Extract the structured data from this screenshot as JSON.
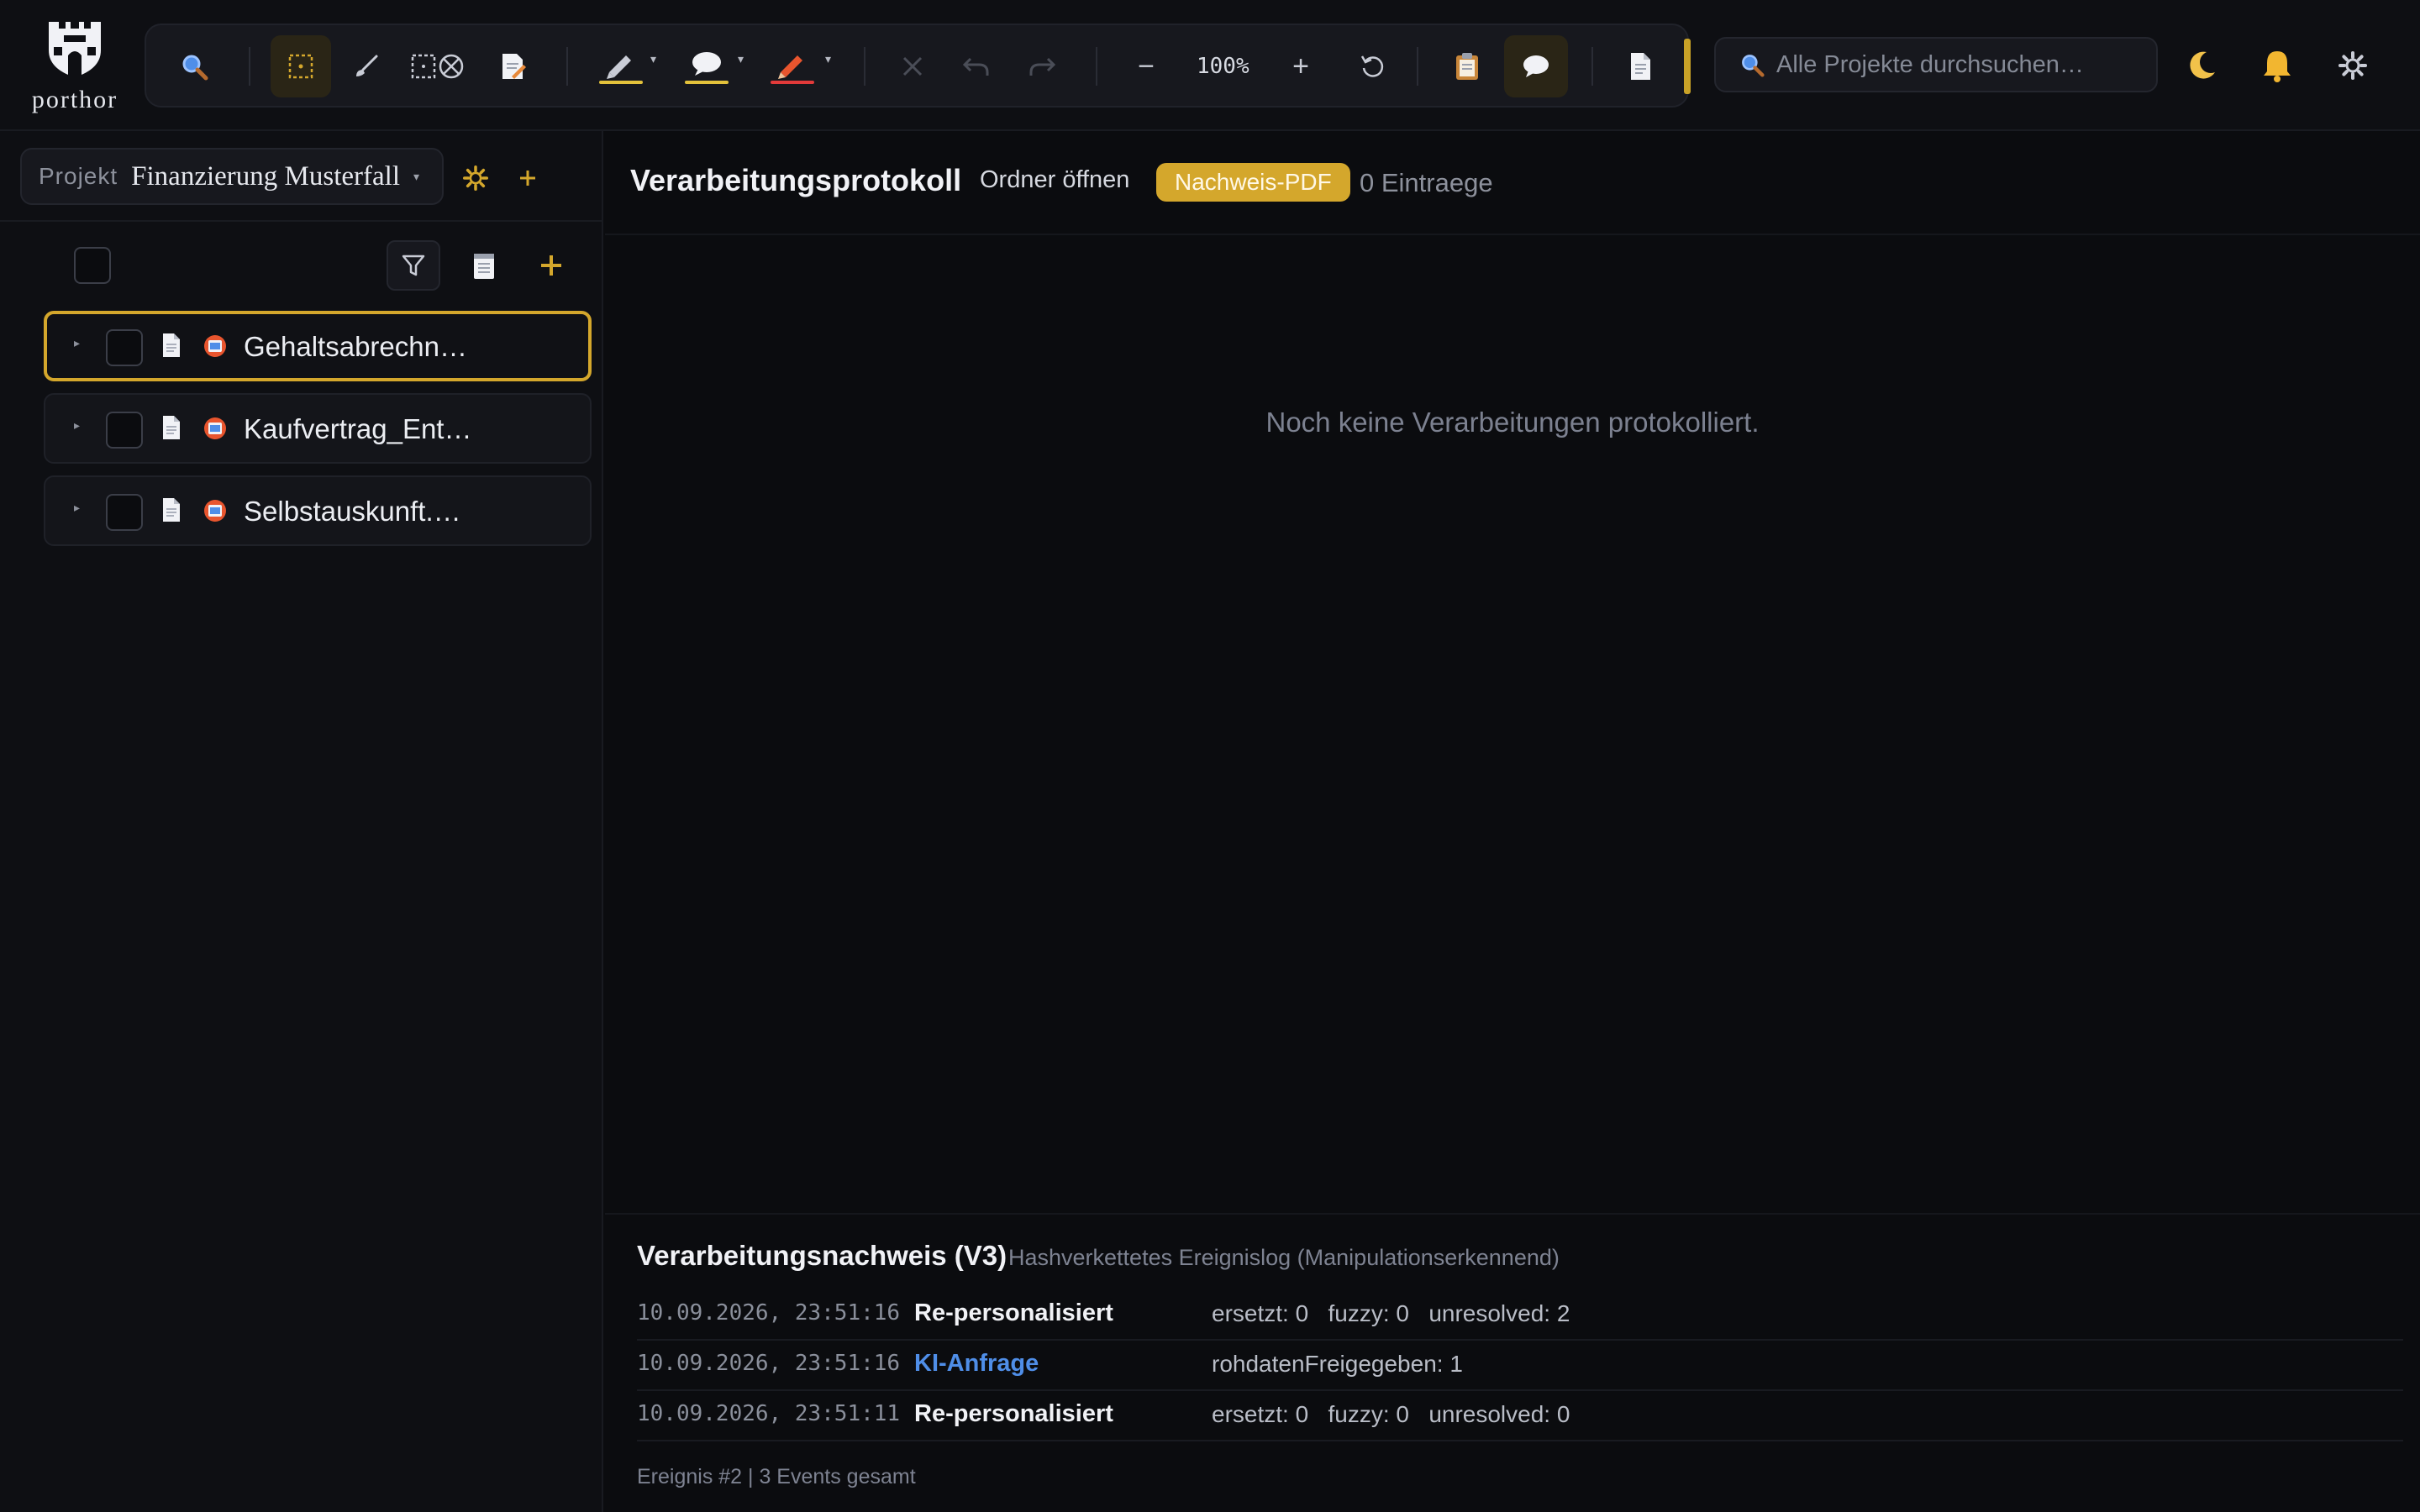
{
  "app": {
    "logo_text": "porthor"
  },
  "toolbar": {
    "zoom": "100%"
  },
  "search": {
    "placeholder": "Alle Projekte durchsuchen…"
  },
  "sidebar": {
    "project_label": "Projekt",
    "project_name": "Finanzierung Musterfall",
    "documents": [
      {
        "name": "Gehaltsabrechn…",
        "selected": true
      },
      {
        "name": "Kaufvertrag_Ent…",
        "selected": false
      },
      {
        "name": "Selbstauskunft.…",
        "selected": false
      }
    ]
  },
  "main": {
    "title": "Verarbeitungsprotokoll",
    "open_folder": "Ordner öffnen",
    "pdf_button": "Nachweis-PDF",
    "entry_count": "0 Eintraege",
    "empty_message": "Noch keine Verarbeitungen protokolliert."
  },
  "proof": {
    "title": "Verarbeitungsnachweis (V3)",
    "subtitle": "Hashverkettetes Ereignislog (Manipulationserkennend)",
    "events": [
      {
        "time": "10.09.2026, 23:51:16",
        "type": "Re-personalisiert",
        "detail": "ersetzt: 0   fuzzy: 0   unresolved: 2"
      },
      {
        "time": "10.09.2026, 23:51:16",
        "type": "KI-Anfrage",
        "detail": "rohdatenFreigegeben: 1"
      },
      {
        "time": "10.09.2026, 23:51:11",
        "type": "Re-personalisiert",
        "detail": "ersetzt: 0   fuzzy: 0   unresolved: 0"
      }
    ],
    "footer": "Ereignis #2 | 3 Events gesamt"
  },
  "colors": {
    "accent": "#d4a72c",
    "link": "#4f8ee8",
    "background": "#0b0c0f"
  }
}
